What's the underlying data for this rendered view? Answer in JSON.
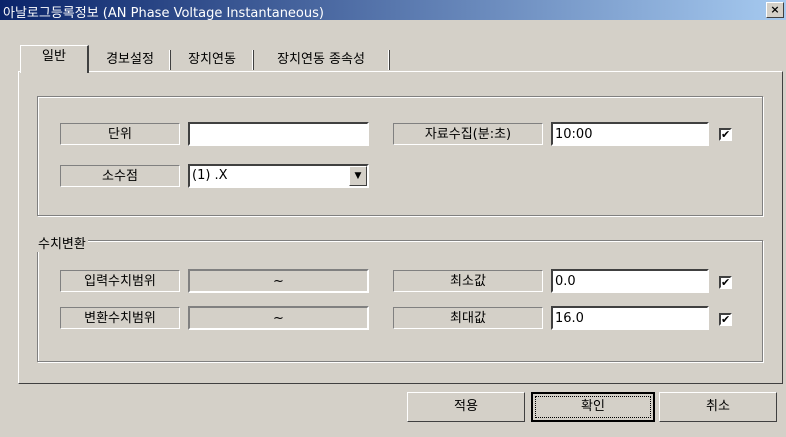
{
  "window": {
    "title": "아날로그등록정보 (AN Phase Voltage Instantaneous)",
    "close_label": "×"
  },
  "tabs": [
    {
      "label": "일반",
      "active": true
    },
    {
      "label": "경보설정",
      "active": false
    },
    {
      "label": "장치연동",
      "active": false
    },
    {
      "label": "장치연동 종속성",
      "active": false
    }
  ],
  "general": {
    "unit_label": "단위",
    "unit_value": "",
    "collection_label": "자료수집(분:초)",
    "collection_value": "10:00",
    "collection_checked": true,
    "decimal_label": "소수점",
    "decimal_value": "(1) .X"
  },
  "conversion": {
    "group_title": "수치변환",
    "input_range_label": "입력수치범위",
    "input_range_value": "~",
    "output_range_label": "변환수치범위",
    "output_range_value": "~",
    "min_label": "최소값",
    "min_value": "0.0",
    "min_checked": true,
    "max_label": "최대값",
    "max_value": "16.0",
    "max_checked": true
  },
  "buttons": {
    "apply": "적용",
    "ok": "확인",
    "cancel": "취소"
  },
  "check_glyph": "✔"
}
